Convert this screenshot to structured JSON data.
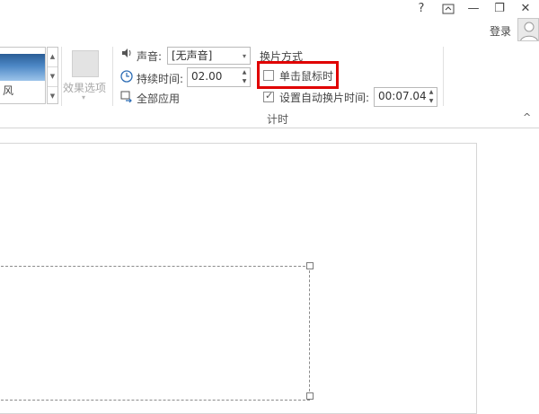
{
  "titlebar": {
    "help": "?",
    "ribbon_display": "⊼",
    "minimize": "—",
    "restore": "❐",
    "close": "✕",
    "login": "登录"
  },
  "gallery": {
    "thumbnail_label": "风"
  },
  "effect_options": {
    "label": "效果选项",
    "arrow": "▾"
  },
  "sound": {
    "label": "声音:",
    "value": "[无声音]"
  },
  "duration": {
    "label": "持续时间:",
    "value": "02.00"
  },
  "apply_all": {
    "label": "全部应用"
  },
  "advance": {
    "title": "换片方式",
    "on_click_label": "单击鼠标时",
    "on_click_checked": false,
    "after_label": "设置自动换片时间:",
    "after_checked": true,
    "after_value": "00:07.04"
  },
  "group_caption": "计时",
  "collapse_glyph": "^"
}
